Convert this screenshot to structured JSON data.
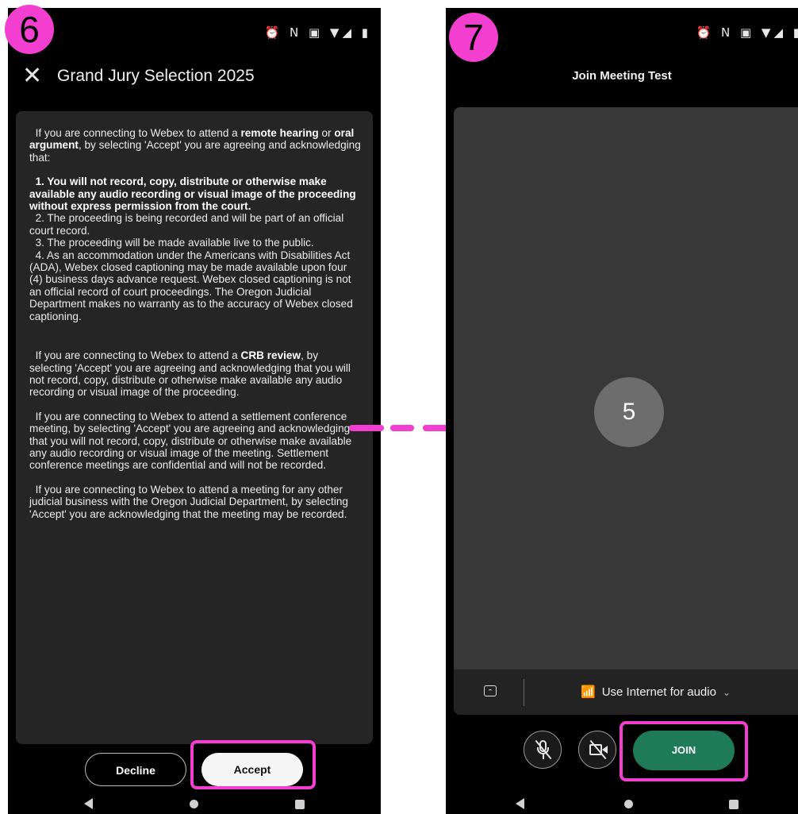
{
  "annotations": {
    "step_left": "6",
    "step_right": "7",
    "accent_color": "#f23fcf"
  },
  "left_screen": {
    "status_icons": "⏰ N ▣ ▼◢ ▮",
    "close_icon": "close-icon",
    "title": "Grand Jury Selection 2025",
    "terms": {
      "p1_pre": "If you are connecting to Webex to attend a ",
      "p1_bold1": "remote hearing",
      "p1_mid": " or ",
      "p1_bold2": "oral argument",
      "p1_post": ", by selecting 'Accept' you are agreeing and acknowledging that:",
      "item1": "1. You will not record, copy, distribute or otherwise make available any audio recording or visual image of the proceeding without express permission from the court.",
      "item2": "2. The proceeding is being recorded and will be part of an official court record.",
      "item3": "3. The proceeding will be made available live to the public.",
      "item4": "4. As an accommodation under the Americans with Disabilities Act (ADA), Webex closed captioning may be made available upon four (4) business days advance request. Webex closed captioning is not an official record of court proceedings. The Oregon Judicial Department makes no warranty as to the accuracy of Webex closed captioning.",
      "p2_pre": "If you are connecting to Webex to attend a ",
      "p2_bold": "CRB review",
      "p2_post": ", by selecting 'Accept' you are agreeing and acknowledging that you will not record, copy, distribute or otherwise make available any audio recording or visual image of the proceeding.",
      "p3": "If you are connecting to Webex to attend a settlement conference meeting, by selecting 'Accept' you are agreeing and acknowledging that you will not record, copy, distribute or otherwise make available any audio recording or visual image of the meeting. Settlement conference meetings are confidential and will not be recorded.",
      "p4": "If you are connecting to Webex to attend a meeting for any other judicial business with the Oregon Judicial Department, by selecting 'Accept' you are acknowledging that the meeting may be recorded."
    },
    "decline_label": "Decline",
    "accept_label": "Accept"
  },
  "right_screen": {
    "status_icons": "⏰ N ▣ ▼◢ ▮",
    "meeting_title": "Join Meeting Test",
    "avatar_number": "5",
    "audio_option": "Use Internet for audio",
    "join_label": "JOIN",
    "join_color": "#1f7a5a"
  }
}
